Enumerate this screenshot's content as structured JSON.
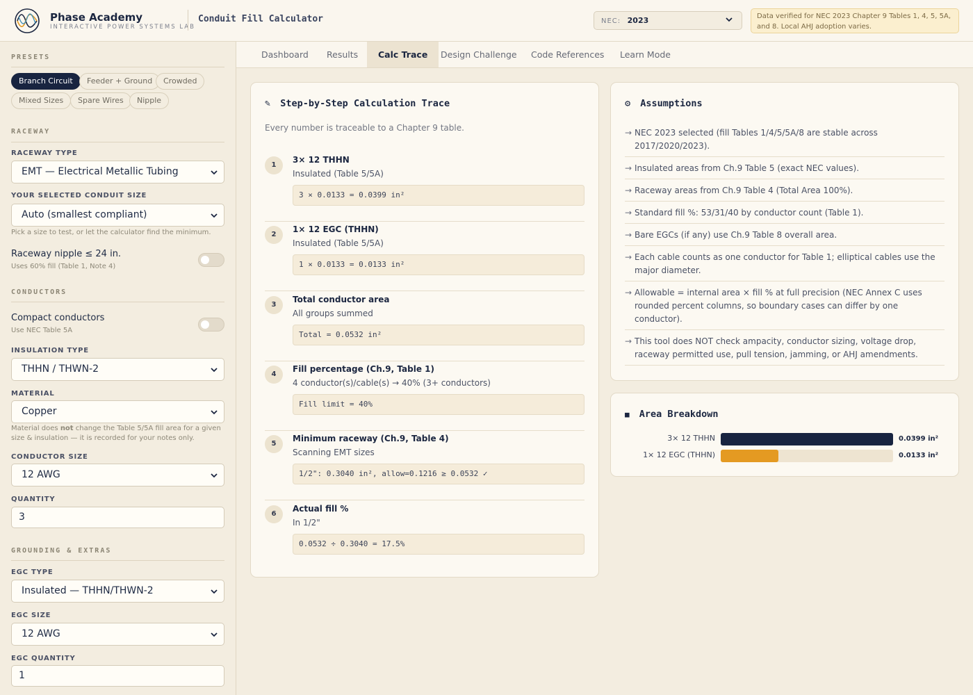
{
  "header": {
    "brand_name": "Phase Academy",
    "brand_tagline": "INTERACTIVE POWER SYSTEMS LAB",
    "app_title": "Conduit Fill Calculator",
    "nec_label": "NEC:",
    "nec_value": "2023",
    "verify_note": "Data verified for NEC 2023 Chapter 9 Tables 1, 4, 5, 5A, and 8. Local AHJ adoption varies."
  },
  "sidebar": {
    "presets_title": "PRESETS",
    "presets": [
      "Branch Circuit",
      "Feeder + Ground",
      "Crowded",
      "Mixed Sizes",
      "Spare Wires",
      "Nipple"
    ],
    "raceway_title": "RACEWAY",
    "raceway_type_label": "RACEWAY TYPE",
    "raceway_type_value": "EMT — Electrical Metallic Tubing",
    "conduit_size_label": "YOUR SELECTED CONDUIT SIZE",
    "conduit_size_value": "Auto (smallest compliant)",
    "conduit_size_hint": "Pick a size to test, or let the calculator find the minimum.",
    "nipple_label": "Raceway nipple ≤ 24 in.",
    "nipple_hint": "Uses 60% fill (Table 1, Note 4)",
    "conductors_title": "CONDUCTORS",
    "compact_label": "Compact conductors",
    "compact_hint": "Use NEC Table 5A",
    "insulation_label": "INSULATION TYPE",
    "insulation_value": "THHN / THWN-2",
    "material_label": "MATERIAL",
    "material_value": "Copper",
    "material_hint_a": "Material does ",
    "material_hint_b": "not",
    "material_hint_c": " change the Table 5/5A fill area for a given size & insulation — it is recorded for your notes only.",
    "conductor_size_label": "CONDUCTOR SIZE",
    "conductor_size_value": "12 AWG",
    "quantity_label": "QUANTITY",
    "quantity_value": "3",
    "grounding_title": "GROUNDING & EXTRAS",
    "egc_type_label": "EGC TYPE",
    "egc_type_value": "Insulated — THHN/THWN-2",
    "egc_size_label": "EGC SIZE",
    "egc_size_value": "12 AWG",
    "egc_qty_label": "EGC QUANTITY",
    "egc_qty_value": "1"
  },
  "tabs": [
    "Dashboard",
    "Results",
    "Calc Trace",
    "Design Challenge",
    "Code References",
    "Learn Mode"
  ],
  "trace": {
    "icon": "✎",
    "title": "Step-by-Step Calculation Trace",
    "subtitle": "Every number is traceable to a Chapter 9 table.",
    "steps": [
      {
        "num": "1",
        "title": "3× 12 THHN",
        "desc": "Insulated (Table 5/5A)",
        "formula": "3 × 0.0133 = 0.0399 in²"
      },
      {
        "num": "2",
        "title": "1× 12 EGC (THHN)",
        "desc": "Insulated (Table 5/5A)",
        "formula": "1 × 0.0133 = 0.0133 in²"
      },
      {
        "num": "3",
        "title": "Total conductor area",
        "desc": "All groups summed",
        "formula": "Total = 0.0532 in²"
      },
      {
        "num": "4",
        "title": "Fill percentage (Ch.9, Table 1)",
        "desc": "4 conductor(s)/cable(s) → 40% (3+ conductors)",
        "formula": "Fill limit = 40%"
      },
      {
        "num": "5",
        "title": "Minimum raceway (Ch.9, Table 4)",
        "desc": "Scanning EMT sizes",
        "formula": "1/2\": 0.3040 in², allow=0.1216 ≥ 0.0532 ✓"
      },
      {
        "num": "6",
        "title": "Actual fill %",
        "desc": "In 1/2\"",
        "formula": "0.0532 ÷ 0.3040 = 17.5%"
      }
    ]
  },
  "assumptions": {
    "icon": "⚙",
    "title": "Assumptions",
    "items": [
      "NEC 2023 selected (fill Tables 1/4/5/5A/8 are stable across 2017/2020/2023).",
      "Insulated areas from Ch.9 Table 5 (exact NEC values).",
      "Raceway areas from Ch.9 Table 4 (Total Area 100%).",
      "Standard fill %: 53/31/40 by conductor count (Table 1).",
      "Bare EGCs (if any) use Ch.9 Table 8 overall area.",
      "Each cable counts as one conductor for Table 1; elliptical cables use the major diameter.",
      "Allowable = internal area × fill % at full precision (NEC Annex C uses rounded percent columns, so boundary cases can differ by one conductor).",
      "This tool does NOT check ampacity, conductor sizing, voltage drop, raceway permitted use, pull tension, jamming, or AHJ amendments."
    ]
  },
  "breakdown": {
    "icon": "■",
    "title": "Area Breakdown",
    "colors": {
      "track": "#eee4d1",
      "series_1": "#182440",
      "series_2": "#e49a22"
    }
  },
  "chart_data": {
    "type": "bar",
    "categories": [
      "3× 12 THHN",
      "1× 12 EGC (THHN)"
    ],
    "values": [
      0.0399,
      0.0133
    ],
    "value_labels": [
      "0.0399 in²",
      "0.0133 in²"
    ],
    "ylim": [
      0,
      0.0399
    ]
  }
}
